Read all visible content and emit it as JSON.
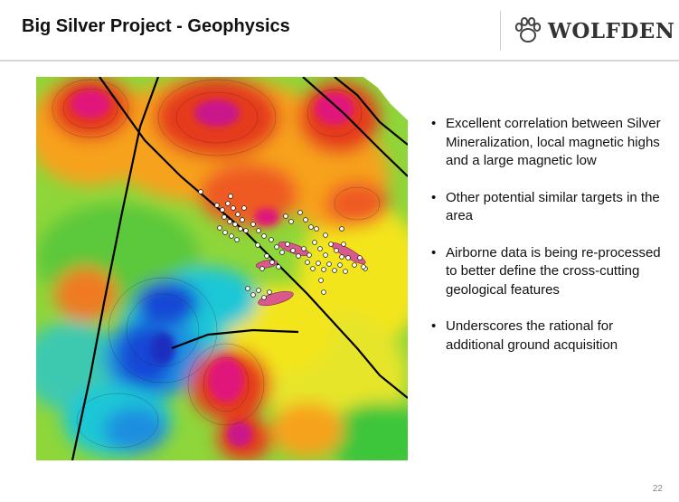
{
  "slide": {
    "title": "Big Silver Project - Geophysics",
    "page_number": "22"
  },
  "logo": {
    "text": "WOLFDEN",
    "icon": "paw-print-icon"
  },
  "bullets": [
    "Excellent correlation between Silver Mineralization, local magnetic highs and a large magnetic low",
    "Other potential similar targets in the area",
    "Airborne data is being re-processed to better define the cross-cutting geological features",
    "Underscores the rational for additional ground acquisition"
  ],
  "map": {
    "icon": "magnetic-survey-map",
    "colors": {
      "magnetic_high": "#e0127a",
      "high": "#e53a1e",
      "mid_high": "#f7a21a",
      "mid": "#f3e51f",
      "mid_low": "#3cc63a",
      "low": "#1ec7d6",
      "very_low": "#1946d6",
      "target_zone": "#d85a8c"
    }
  }
}
